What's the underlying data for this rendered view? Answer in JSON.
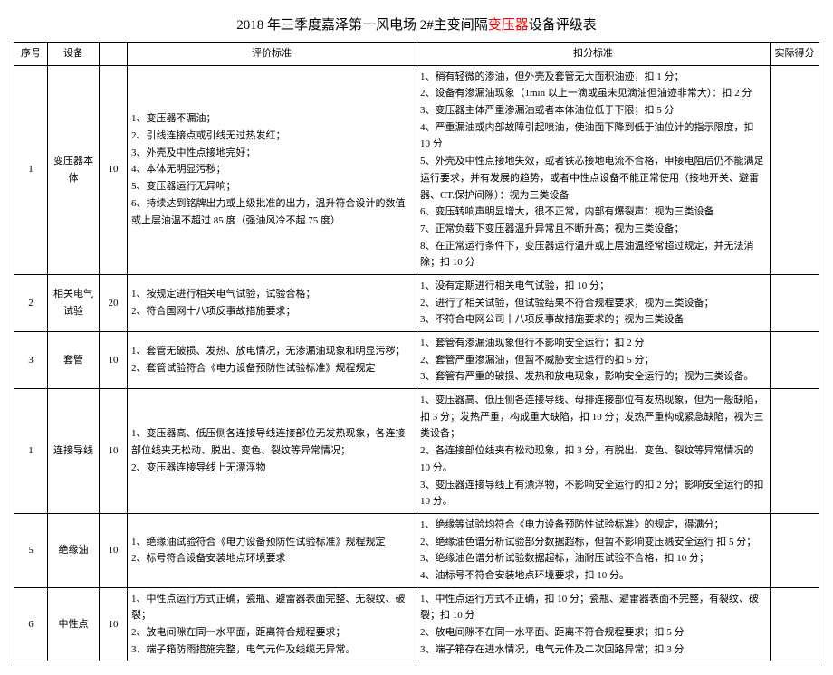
{
  "title_prefix": "2018 年三季度嘉泽第一风电场 2#主变间隔",
  "title_hl": "变压器",
  "title_suffix": "设备评级表",
  "headers": {
    "idx": "序号",
    "device": "设备",
    "std": "评价标准",
    "ded": "扣分标准",
    "actual": "实际得分"
  },
  "rows": [
    {
      "idx": "1",
      "device": "变压器本体",
      "score": "10",
      "std": "1、变压器不漏油；\n2、引线连接点或引线无过热发红；\n3、外壳及中性点接地完好；\n4、本体无明显污秽；\n5、变压器运行无异响；\n6、持续达到铭牌出力或上级批准的出力，温升符合设计的数值或上层油温不超过 85 度（强油风冷不超 75 度）",
      "ded": "1、稍有轻微的渗油，但外壳及套管无大面积油迹，扣 1 分；\n2、设备有渗漏油现象（1min 以上一滴或虽未见滴油但油迹非常大）：扣 2 分\n3、变压器主体严重渗漏油或者本体油位低于下限；扣 5 分\n4、严重漏油或内部故障引起喷油，使油面下降到低于油位计的指示限度，扣 10 分\n5、外壳及中性点接地失效，或者铁芯接地电流不合格，申接电阻后仍不能满足运行要求，并有发展的趋势，或者中性点设备不能正常使用（接地开关、避雷器、CT.保护间隙）：视为三类设备\n6、变压转响声明显增大，很不正常，内部有爆裂声：视为三类设备\n7、正常负载下变压器温升异常且不断升高；视为三类设备；\n8、在正常运行条件下，变压器运行温升或上层油温经常超过规定，并无法消除；扣 10 分"
    },
    {
      "idx": "2",
      "device": "相关电气试验",
      "score": "20",
      "std": "1、按规定进行相关电气试验，试验合格；\n2、符合国网十八项反事故措施要求；",
      "ded": "1、没有定期进行相关电气试验，扣 10 分；\n2、进行了相关试验，但试验结果不符合规程要求，视为三类设备；\n3、不符合电网公司十八项反事故措施要求的；视为三类设备"
    },
    {
      "idx": "3",
      "device": "套管",
      "score": "10",
      "std": "1、套管无破损、发热、放电情况，无渗漏油现象和明显污秽；\n2、套管试验符合《电力设备预防性试验标准》规程规定",
      "ded": "1、套管有渗漏油现象但行不影响安全运行；扣 2 分\n2、套管严重渗漏油，但暂不威胁安全运行的扣 5 分；\n3、套管有严重的破损、发热和放电现象，影响安全运行的；视为三类设备。"
    },
    {
      "idx": "1",
      "device": "连接导线",
      "score": "10",
      "std": "1、变压器高、低压侧各连接导线连接部位无发热现象，各连接部位线夹无松动、脱出、变色、裂纹等异常情况；\n2、变压器连接导线上无漂浮物",
      "ded": "1、变压器高、低压侧各连接导线、母排连接部位有发热现象，但为一般缺陷，扣 3 分；发热严重，构成重大缺陷，扣 10 分；发热严重构成紧急缺陷，视为三类设备；\n2、各连接部位线夹有松动现象，扣 3 分，有脱出、变色、裂纹等异常情况的 10 分。\n3、变压器连接导线上有漂浮物，不影响安全运行的扣 2 分；影响安全运行的扣 10 分。"
    },
    {
      "idx": "5",
      "device": "绝缘油",
      "score": "10",
      "std": "1、绝缘油试验符合《电力设备预防性试验标准》规程规定\n2、标号符合设备安装地点环境要求",
      "ded": "1、绝缘等试验均符合《电力设备预防性试验标准》的规定，得满分；\n2、绝缘油色谱分析试验部分数据超标，但暂不影响变压溅安全运行 扣 5 分；\n3、绝缘油色谱分析试验数据超标，油耐压试验不合格，扣 10 分；\n4、油标号不符合安装地点环境要求，扣 10 分。"
    },
    {
      "idx": "6",
      "device": "中性点",
      "score": "10",
      "std": "1、中性点运行方式正确，瓷瓶、避雷器表面完整、无裂纹、破裂；\n2、放电间隙在同一水平面，距离符合规程要求；\n3、端子箱防雨措施完整，电气元件及线缆无异常。",
      "ded": "1、中性点运行方式不正确，扣 10 分；瓷瓶、避雷器表面不完整，有裂纹、破裂；扣 10 分\n2、放电间隙不在同一水平面、距离不符合规程要求；扣 5 分\n3、端子箱存在进水情况，电气元件及二次回路异常；扣 3 分"
    }
  ]
}
